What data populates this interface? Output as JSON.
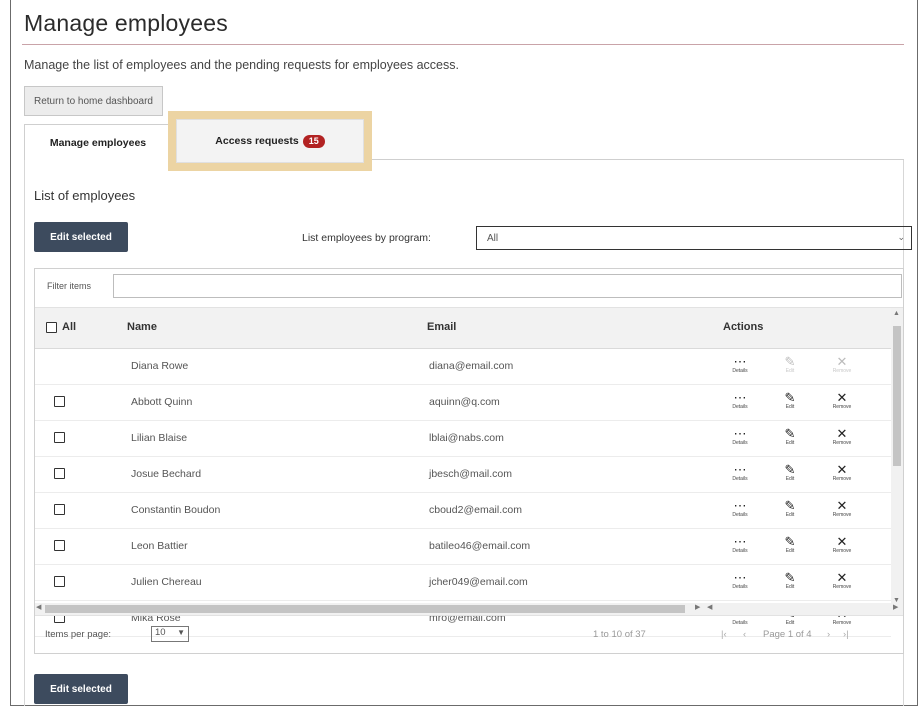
{
  "page": {
    "title": "Manage employees",
    "subtitle": "Manage the list of employees and the pending requests for employees access.",
    "return_button": "Return to home dashboard"
  },
  "tabs": [
    {
      "label": "Manage employees",
      "active": true
    },
    {
      "label": "Access requests",
      "badge": "15",
      "highlighted": true
    }
  ],
  "list": {
    "heading": "List of employees",
    "edit_selected_label": "Edit selected",
    "program_filter_label": "List employees by program:",
    "program_filter_value": "All"
  },
  "grid": {
    "filter_label": "Filter items",
    "filter_value": "",
    "columns": {
      "all": "All",
      "name": "Name",
      "email": "Email",
      "actions": "Actions"
    },
    "action_labels": {
      "details": "Details",
      "edit": "Edit",
      "remove": "Remove"
    },
    "rows": [
      {
        "name": "Diana Rowe",
        "email": "diana@email.com",
        "checkbox": false,
        "disabled": true
      },
      {
        "name": "Abbott Quinn",
        "email": "aquinn@q.com",
        "checkbox": true
      },
      {
        "name": "Lilian Blaise",
        "email": "lblai@nabs.com",
        "checkbox": true
      },
      {
        "name": "Josue Bechard",
        "email": "jbesch@mail.com",
        "checkbox": true
      },
      {
        "name": "Constantin Boudon",
        "email": "cboud2@email.com",
        "checkbox": true
      },
      {
        "name": "Leon Battier",
        "email": "batileo46@email.com",
        "checkbox": true
      },
      {
        "name": "Julien Chereau",
        "email": "jcher049@email.com",
        "checkbox": true
      },
      {
        "name": "Mika Rose",
        "email": "mro@email.com",
        "checkbox": true
      }
    ]
  },
  "pager": {
    "items_per_page_label": "Items per page:",
    "items_per_page_value": "10",
    "range_text": "1 to 10 of 37",
    "page_text": "Page 1 of 4"
  },
  "colors": {
    "accent_dark": "#3d4b5e",
    "badge": "#b22222",
    "highlight": "#ecd4a3"
  },
  "icons": [
    "details-icon",
    "edit-pencil-icon",
    "remove-x-icon",
    "chevron-down-icon",
    "first-page-icon",
    "prev-page-icon",
    "next-page-icon",
    "last-page-icon"
  ]
}
